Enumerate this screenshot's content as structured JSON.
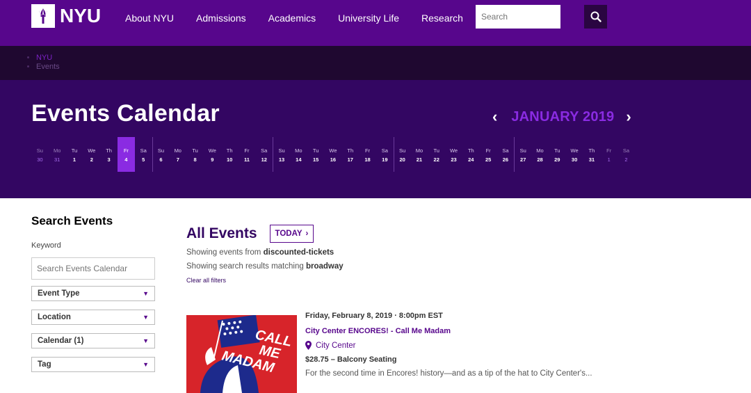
{
  "nav": {
    "logo_text": "NYU",
    "links": [
      "About NYU",
      "Admissions",
      "Academics",
      "University Life",
      "Research"
    ],
    "search_placeholder": "Search"
  },
  "breadcrumb": [
    "NYU",
    "Events"
  ],
  "hero": {
    "title": "Events Calendar",
    "month": "JANUARY 2019",
    "prev_icon": "chevron-left-icon",
    "next_icon": "chevron-right-icon"
  },
  "calendar": {
    "days": [
      {
        "dow": "Su",
        "num": "30",
        "other": true
      },
      {
        "dow": "Mo",
        "num": "31",
        "other": true
      },
      {
        "dow": "Tu",
        "num": "1"
      },
      {
        "dow": "We",
        "num": "2"
      },
      {
        "dow": "Th",
        "num": "3"
      },
      {
        "dow": "Fr",
        "num": "4",
        "selected": true
      },
      {
        "dow": "Sa",
        "num": "5"
      },
      {
        "dow": "Su",
        "num": "6"
      },
      {
        "dow": "Mo",
        "num": "7"
      },
      {
        "dow": "Tu",
        "num": "8"
      },
      {
        "dow": "We",
        "num": "9"
      },
      {
        "dow": "Th",
        "num": "10"
      },
      {
        "dow": "Fr",
        "num": "11"
      },
      {
        "dow": "Sa",
        "num": "12"
      },
      {
        "dow": "Su",
        "num": "13"
      },
      {
        "dow": "Mo",
        "num": "14"
      },
      {
        "dow": "Tu",
        "num": "15"
      },
      {
        "dow": "We",
        "num": "16"
      },
      {
        "dow": "Th",
        "num": "17"
      },
      {
        "dow": "Fr",
        "num": "18"
      },
      {
        "dow": "Sa",
        "num": "19"
      },
      {
        "dow": "Su",
        "num": "20"
      },
      {
        "dow": "Mo",
        "num": "21"
      },
      {
        "dow": "Tu",
        "num": "22"
      },
      {
        "dow": "We",
        "num": "23"
      },
      {
        "dow": "Th",
        "num": "24"
      },
      {
        "dow": "Fr",
        "num": "25"
      },
      {
        "dow": "Sa",
        "num": "26"
      },
      {
        "dow": "Su",
        "num": "27"
      },
      {
        "dow": "Mo",
        "num": "28"
      },
      {
        "dow": "Tu",
        "num": "29"
      },
      {
        "dow": "We",
        "num": "30"
      },
      {
        "dow": "Th",
        "num": "31"
      },
      {
        "dow": "Fr",
        "num": "1",
        "other": true
      },
      {
        "dow": "Sa",
        "num": "2",
        "other": true
      }
    ]
  },
  "sidebar": {
    "title": "Search Events",
    "keyword_label": "Keyword",
    "search_placeholder": "Search Events Calendar",
    "filters": [
      "Event Type",
      "Location",
      "Calendar (1)",
      "Tag"
    ]
  },
  "main": {
    "title": "All Events",
    "today_label": "TODAY",
    "showing_prefix": "Showing events from",
    "showing_value": "discounted-tickets",
    "matching_prefix": "Showing search results matching",
    "matching_value": "broadway",
    "clear_label": "Clear all filters"
  },
  "event": {
    "date": "Friday, February 8, 2019 · 8:00pm EST",
    "title": "City Center ENCORES! - Call Me Madam",
    "venue": "City Center",
    "price": "$28.75 – Balcony Seating",
    "description": "For the second time in Encores! history—and as a tip of the hat to City Center's...",
    "image_text": [
      "CALL",
      "ME",
      "MADAM"
    ]
  },
  "colors": {
    "nav_bg": "#57068c",
    "hero_bg": "#330662",
    "accent": "#8a2be2"
  }
}
